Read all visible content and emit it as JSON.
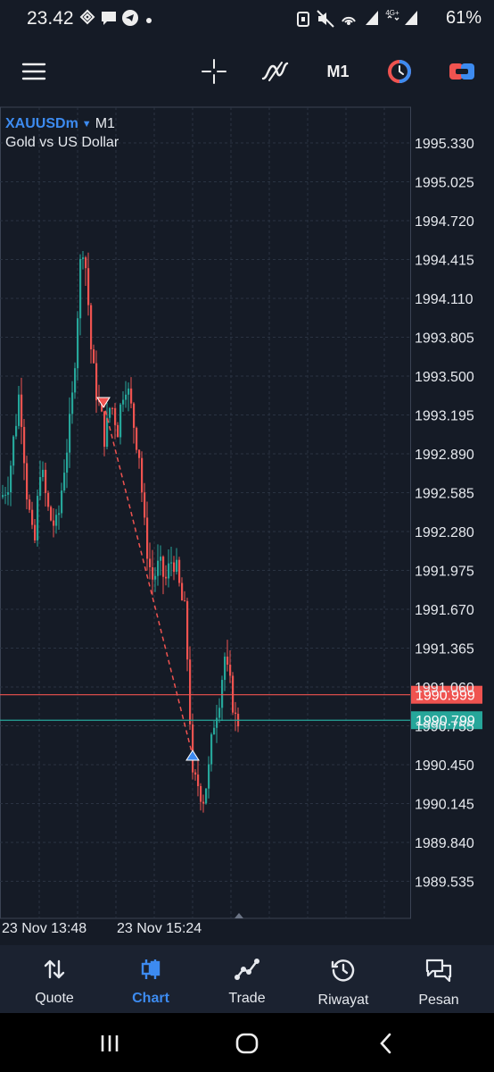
{
  "status_bar": {
    "time": "23.42",
    "battery": "61%",
    "network": "4G+"
  },
  "toolbar": {
    "timeframe": "M1",
    "icons": [
      "menu-icon",
      "crosshair-icon",
      "indicators-icon",
      "one-click-trading-icon",
      "trade-icon"
    ]
  },
  "chart": {
    "symbol": "XAUUSDm",
    "timeframe": "M1",
    "description": "Gold vs US Dollar",
    "price_axis": [
      "1995.330",
      "1995.025",
      "1994.720",
      "1994.415",
      "1994.110",
      "1993.805",
      "1993.500",
      "1993.195",
      "1992.890",
      "1992.585",
      "1992.280",
      "1991.975",
      "1991.670",
      "1991.365",
      "1991.060",
      "1990.755",
      "1990.450",
      "1990.145",
      "1989.840",
      "1989.535"
    ],
    "ask_price": "1990.999",
    "bid_price": "1990.799",
    "time_axis": [
      "23 Nov 13:48",
      "23 Nov 15:24"
    ],
    "colors": {
      "bull": "#26a69a",
      "bear": "#ef5350",
      "ask": "#ef5350",
      "bid": "#26a69a",
      "grid": "#2a3342"
    },
    "trade": {
      "sell_entry": 1993.29,
      "buy_exit": 1990.52
    }
  },
  "bottom_nav": {
    "items": [
      {
        "label": "Quote",
        "icon": "quotes-icon"
      },
      {
        "label": "Chart",
        "icon": "chart-icon",
        "active": true
      },
      {
        "label": "Trade",
        "icon": "trade-icon"
      },
      {
        "label": "Riwayat",
        "icon": "history-icon"
      },
      {
        "label": "Pesan",
        "icon": "messages-icon"
      }
    ]
  }
}
